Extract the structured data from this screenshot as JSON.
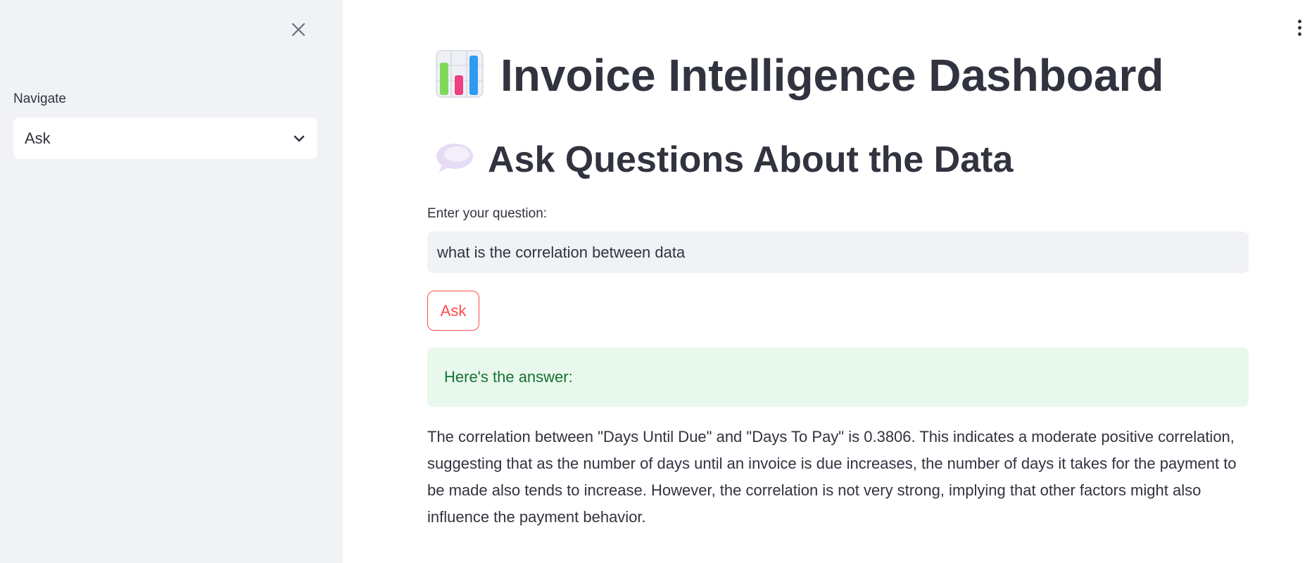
{
  "sidebar": {
    "close_icon": "close-icon",
    "nav_label": "Navigate",
    "nav_selected": "Ask"
  },
  "main": {
    "title_icon": "bar-chart-icon",
    "title": "Invoice Intelligence Dashboard",
    "section_icon": "speech-bubble-icon",
    "section_title": "Ask Questions About the Data",
    "question_label": "Enter your question:",
    "question_value": "what is the correlation between data",
    "ask_button": "Ask",
    "answer_header": "Here's the answer:",
    "answer_text": "The correlation between \"Days Until Due\" and \"Days To Pay\" is 0.3806. This indicates a moderate positive correlation, suggesting that as the number of days until an invoice is due increases, the number of days it takes for the payment to be made also tends to increase. However, the correlation is not very strong, implying that other factors might also influence the payment behavior."
  },
  "colors": {
    "sidebar_bg": "#f0f2f6",
    "text": "#31333f",
    "accent": "#ff4b4b",
    "success_bg": "#e8f8ec",
    "success_text": "#177233"
  }
}
